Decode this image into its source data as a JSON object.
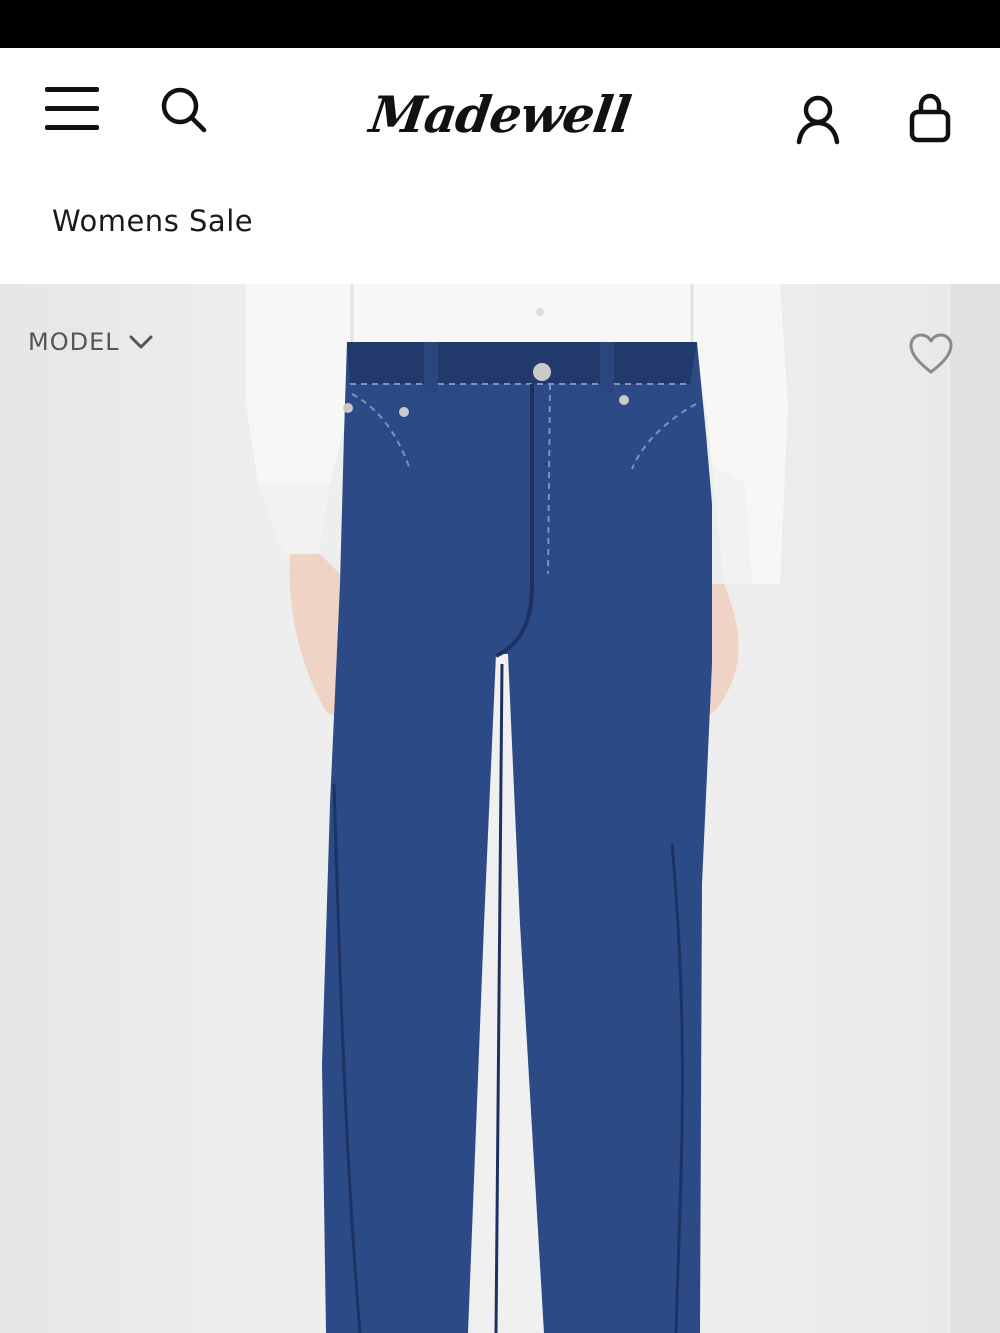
{
  "header": {
    "brand": "Madewell",
    "breadcrumb": "Womens Sale"
  },
  "gallery": {
    "model_toggle_label": "MODEL"
  },
  "icons": {
    "menu": "hamburger-menu-icon",
    "search": "search-icon",
    "account": "user-icon",
    "bag": "shopping-bag-icon",
    "model_toggle": "chevron-down-icon",
    "wishlist": "heart-icon"
  },
  "colors": {
    "top_bar": "#000000",
    "text": "#1a1a1a",
    "denim": "#2c4a86",
    "denim_dark": "#22396c",
    "shirt": "#f7f7f5",
    "background": "#ececec"
  }
}
